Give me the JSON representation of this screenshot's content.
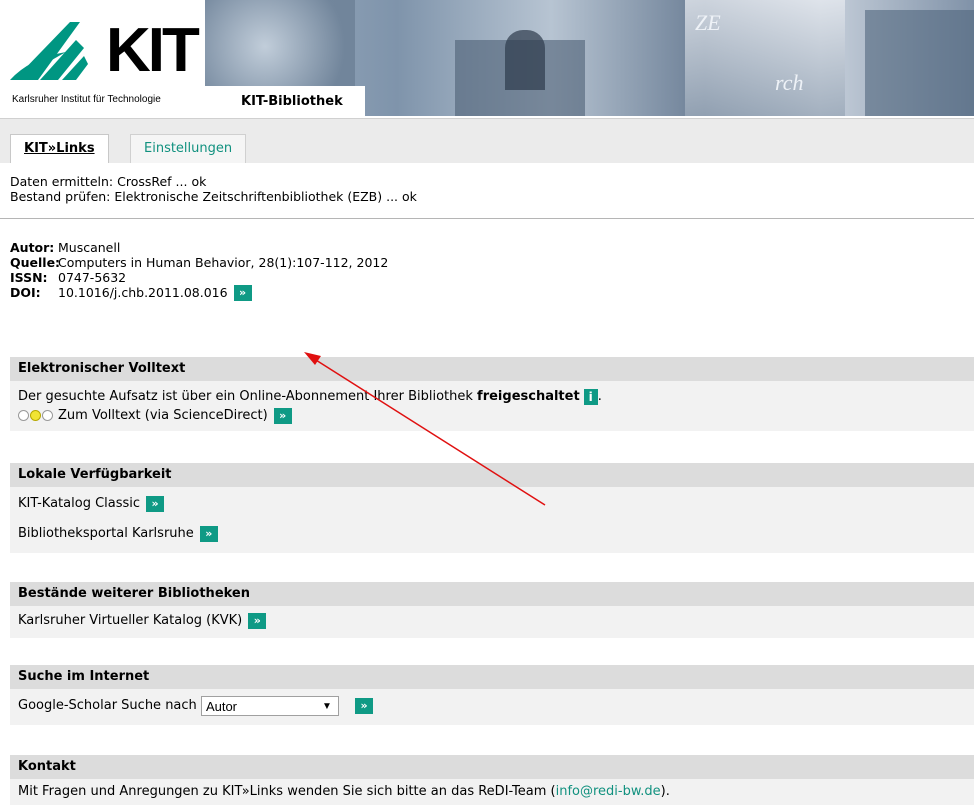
{
  "header": {
    "logo_text": "KIT",
    "institute": "Karlsruher Institut für Technologie",
    "library": "KIT-Bibliothek"
  },
  "tabs": [
    {
      "label": "KIT»Links"
    },
    {
      "label": "Einstellungen"
    }
  ],
  "status": [
    "Daten ermitteln: CrossRef ... ok",
    "Bestand prüfen: Elektronische Zeitschriftenbibliothek (EZB) ... ok"
  ],
  "meta": {
    "author_label": "Autor:",
    "author": "Muscanell",
    "source_label": "Quelle:",
    "source": "Computers in Human Behavior, 28(1):107-112, 2012",
    "issn_label": "ISSN:",
    "issn": "0747-5632",
    "doi_label": "DOI:",
    "doi": "10.1016/j.chb.2011.08.016"
  },
  "go_symbol": "»",
  "info_symbol": "i",
  "volltext": {
    "title": "Elektronischer Volltext",
    "text_before": "Der gesuchte Aufsatz ist über ein Online-Abonnement Ihrer Bibliothek",
    "text_bold": "freigeschaltet",
    "text_after": ".",
    "link": "Zum Volltext (via ScienceDirect)"
  },
  "lokal": {
    "title": "Lokale Verfügbarkeit",
    "items": [
      "KIT-Katalog Classic",
      "Bibliotheksportal Karlsruhe"
    ]
  },
  "weitere": {
    "title": "Bestände weiterer Bibliotheken",
    "items": [
      "Karlsruher Virtueller Katalog (KVK)"
    ]
  },
  "internet": {
    "title": "Suche im Internet",
    "label": "Google-Scholar Suche nach",
    "selected": "Autor"
  },
  "kontakt": {
    "title": "Kontakt",
    "text": "Mit Fragen und Anregungen zu KIT»Links wenden Sie sich bitte an das ReDI-Team (",
    "email": "info@redi-bw.de",
    "text_end": ")."
  },
  "colors": {
    "accent": "#0f9a85",
    "annotation_arrow": "#e01010"
  }
}
